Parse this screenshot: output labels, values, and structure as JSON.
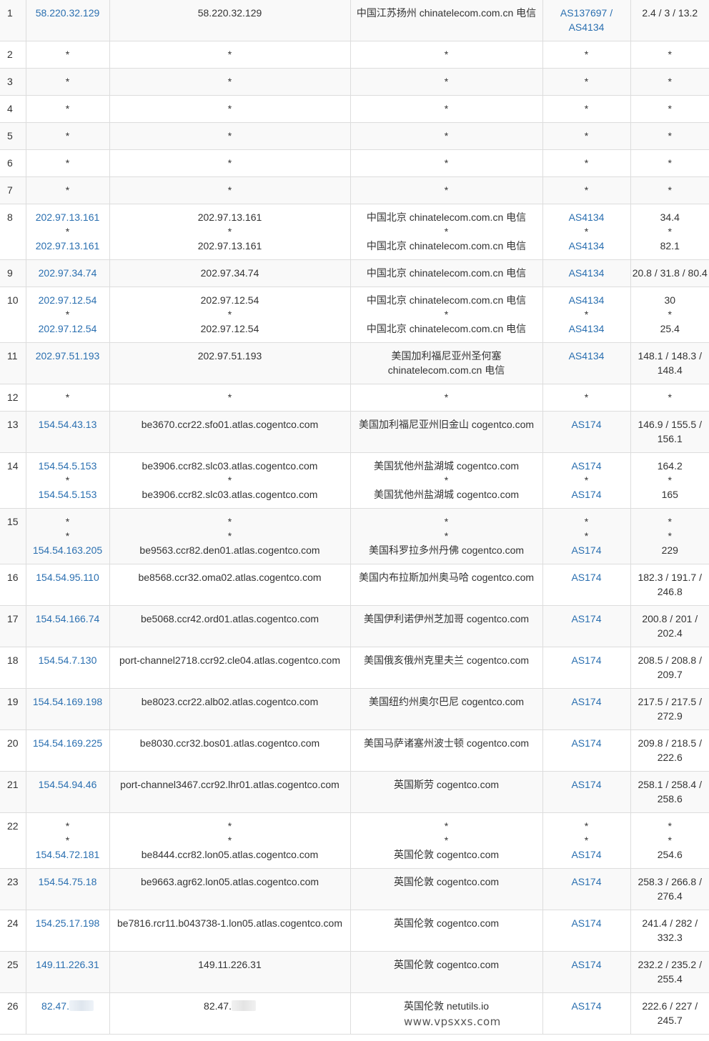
{
  "rows": [
    {
      "hop": "1",
      "ip": [
        "58.220.32.129"
      ],
      "host": [
        "58.220.32.129"
      ],
      "loc": [
        "中国江苏扬州 chinatelecom.com.cn 电信"
      ],
      "asn": [
        "AS137697 / AS4134"
      ],
      "lat": [
        "2.4 / 3 / 13.2"
      ]
    },
    {
      "hop": "2",
      "ip": [
        "*"
      ],
      "host": [
        "*"
      ],
      "loc": [
        "*"
      ],
      "asn": [
        "*"
      ],
      "lat": [
        "*"
      ]
    },
    {
      "hop": "3",
      "ip": [
        "*"
      ],
      "host": [
        "*"
      ],
      "loc": [
        "*"
      ],
      "asn": [
        "*"
      ],
      "lat": [
        "*"
      ]
    },
    {
      "hop": "4",
      "ip": [
        "*"
      ],
      "host": [
        "*"
      ],
      "loc": [
        "*"
      ],
      "asn": [
        "*"
      ],
      "lat": [
        "*"
      ]
    },
    {
      "hop": "5",
      "ip": [
        "*"
      ],
      "host": [
        "*"
      ],
      "loc": [
        "*"
      ],
      "asn": [
        "*"
      ],
      "lat": [
        "*"
      ]
    },
    {
      "hop": "6",
      "ip": [
        "*"
      ],
      "host": [
        "*"
      ],
      "loc": [
        "*"
      ],
      "asn": [
        "*"
      ],
      "lat": [
        "*"
      ]
    },
    {
      "hop": "7",
      "ip": [
        "*"
      ],
      "host": [
        "*"
      ],
      "loc": [
        "*"
      ],
      "asn": [
        "*"
      ],
      "lat": [
        "*"
      ]
    },
    {
      "hop": "8",
      "ip": [
        "202.97.13.161",
        "*",
        "202.97.13.161"
      ],
      "host": [
        "202.97.13.161",
        "*",
        "202.97.13.161"
      ],
      "loc": [
        "中国北京 chinatelecom.com.cn 电信",
        "*",
        "中国北京 chinatelecom.com.cn 电信"
      ],
      "asn": [
        "AS4134",
        "*",
        "AS4134"
      ],
      "lat": [
        "34.4",
        "*",
        "82.1"
      ]
    },
    {
      "hop": "9",
      "ip": [
        "202.97.34.74"
      ],
      "host": [
        "202.97.34.74"
      ],
      "loc": [
        "中国北京 chinatelecom.com.cn 电信"
      ],
      "asn": [
        "AS4134"
      ],
      "lat": [
        "20.8 / 31.8 / 80.4"
      ]
    },
    {
      "hop": "10",
      "ip": [
        "202.97.12.54",
        "*",
        "202.97.12.54"
      ],
      "host": [
        "202.97.12.54",
        "*",
        "202.97.12.54"
      ],
      "loc": [
        "中国北京 chinatelecom.com.cn 电信",
        "*",
        "中国北京 chinatelecom.com.cn 电信"
      ],
      "asn": [
        "AS4134",
        "*",
        "AS4134"
      ],
      "lat": [
        "30",
        "*",
        "25.4"
      ]
    },
    {
      "hop": "11",
      "ip": [
        "202.97.51.193"
      ],
      "host": [
        "202.97.51.193"
      ],
      "loc": [
        "美国加利福尼亚州圣何塞 chinatelecom.com.cn 电信"
      ],
      "asn": [
        "AS4134"
      ],
      "lat": [
        "148.1 / 148.3 / 148.4"
      ]
    },
    {
      "hop": "12",
      "ip": [
        "*"
      ],
      "host": [
        "*"
      ],
      "loc": [
        "*"
      ],
      "asn": [
        "*"
      ],
      "lat": [
        "*"
      ]
    },
    {
      "hop": "13",
      "ip": [
        "154.54.43.13"
      ],
      "host": [
        "be3670.ccr22.sfo01.atlas.cogentco.com"
      ],
      "loc": [
        "美国加利福尼亚州旧金山 cogentco.com"
      ],
      "asn": [
        "AS174"
      ],
      "lat": [
        "146.9 / 155.5 / 156.1"
      ]
    },
    {
      "hop": "14",
      "ip": [
        "154.54.5.153",
        "*",
        "154.54.5.153"
      ],
      "host": [
        "be3906.ccr82.slc03.atlas.cogentco.com",
        "*",
        "be3906.ccr82.slc03.atlas.cogentco.com"
      ],
      "loc": [
        "美国犹他州盐湖城 cogentco.com",
        "*",
        "美国犹他州盐湖城 cogentco.com"
      ],
      "asn": [
        "AS174",
        "*",
        "AS174"
      ],
      "lat": [
        "164.2",
        "*",
        "165"
      ]
    },
    {
      "hop": "15",
      "ip": [
        "*",
        "*",
        "154.54.163.205"
      ],
      "host": [
        "*",
        "*",
        "be9563.ccr82.den01.atlas.cogentco.com"
      ],
      "loc": [
        "*",
        "*",
        "美国科罗拉多州丹佛 cogentco.com"
      ],
      "asn": [
        "*",
        "*",
        "AS174"
      ],
      "lat": [
        "*",
        "*",
        "229"
      ]
    },
    {
      "hop": "16",
      "ip": [
        "154.54.95.110"
      ],
      "host": [
        "be8568.ccr32.oma02.atlas.cogentco.com"
      ],
      "loc": [
        "美国内布拉斯加州奥马哈 cogentco.com"
      ],
      "asn": [
        "AS174"
      ],
      "lat": [
        "182.3 / 191.7 / 246.8"
      ]
    },
    {
      "hop": "17",
      "ip": [
        "154.54.166.74"
      ],
      "host": [
        "be5068.ccr42.ord01.atlas.cogentco.com"
      ],
      "loc": [
        "美国伊利诺伊州芝加哥 cogentco.com"
      ],
      "asn": [
        "AS174"
      ],
      "lat": [
        "200.8 / 201 / 202.4"
      ]
    },
    {
      "hop": "18",
      "ip": [
        "154.54.7.130"
      ],
      "host": [
        "port-channel2718.ccr92.cle04.atlas.cogentco.com"
      ],
      "loc": [
        "美国俄亥俄州克里夫兰 cogentco.com"
      ],
      "asn": [
        "AS174"
      ],
      "lat": [
        "208.5 / 208.8 / 209.7"
      ]
    },
    {
      "hop": "19",
      "ip": [
        "154.54.169.198"
      ],
      "host": [
        "be8023.ccr22.alb02.atlas.cogentco.com"
      ],
      "loc": [
        "美国纽约州奥尔巴尼 cogentco.com"
      ],
      "asn": [
        "AS174"
      ],
      "lat": [
        "217.5 / 217.5 / 272.9"
      ]
    },
    {
      "hop": "20",
      "ip": [
        "154.54.169.225"
      ],
      "host": [
        "be8030.ccr32.bos01.atlas.cogentco.com"
      ],
      "loc": [
        "美国马萨诸塞州波士顿 cogentco.com"
      ],
      "asn": [
        "AS174"
      ],
      "lat": [
        "209.8 / 218.5 / 222.6"
      ]
    },
    {
      "hop": "21",
      "ip": [
        "154.54.94.46"
      ],
      "host": [
        "port-channel3467.ccr92.lhr01.atlas.cogentco.com"
      ],
      "loc": [
        "英国斯劳 cogentco.com"
      ],
      "asn": [
        "AS174"
      ],
      "lat": [
        "258.1 / 258.4 / 258.6"
      ]
    },
    {
      "hop": "22",
      "ip": [
        "*",
        "*",
        "154.54.72.181"
      ],
      "host": [
        "*",
        "*",
        "be8444.ccr82.lon05.atlas.cogentco.com"
      ],
      "loc": [
        "*",
        "*",
        "英国伦敦 cogentco.com"
      ],
      "asn": [
        "*",
        "*",
        "AS174"
      ],
      "lat": [
        "*",
        "*",
        "254.6"
      ]
    },
    {
      "hop": "23",
      "ip": [
        "154.54.75.18"
      ],
      "host": [
        "be9663.agr62.lon05.atlas.cogentco.com"
      ],
      "loc": [
        "英国伦敦 cogentco.com"
      ],
      "asn": [
        "AS174"
      ],
      "lat": [
        "258.3 / 266.8 / 276.4"
      ]
    },
    {
      "hop": "24",
      "ip": [
        "154.25.17.198"
      ],
      "host": [
        "be7816.rcr11.b043738-1.lon05.atlas.cogentco.com"
      ],
      "loc": [
        "英国伦敦 cogentco.com"
      ],
      "asn": [
        "AS174"
      ],
      "lat": [
        "241.4 / 282 / 332.3"
      ]
    },
    {
      "hop": "25",
      "ip": [
        "149.11.226.31"
      ],
      "host": [
        "149.11.226.31"
      ],
      "loc": [
        "英国伦敦 cogentco.com"
      ],
      "asn": [
        "AS174"
      ],
      "lat": [
        "232.2 / 235.2 / 255.4"
      ]
    },
    {
      "hop": "26",
      "ip": [
        "82.47."
      ],
      "host": [
        "82.47."
      ],
      "loc": [
        "英国伦敦 netutils.io"
      ],
      "asn": [
        "AS174"
      ],
      "lat": [
        "222.6 / 227 / 245.7"
      ],
      "masked": true
    }
  ],
  "watermark": "www.vpsxxs.com"
}
